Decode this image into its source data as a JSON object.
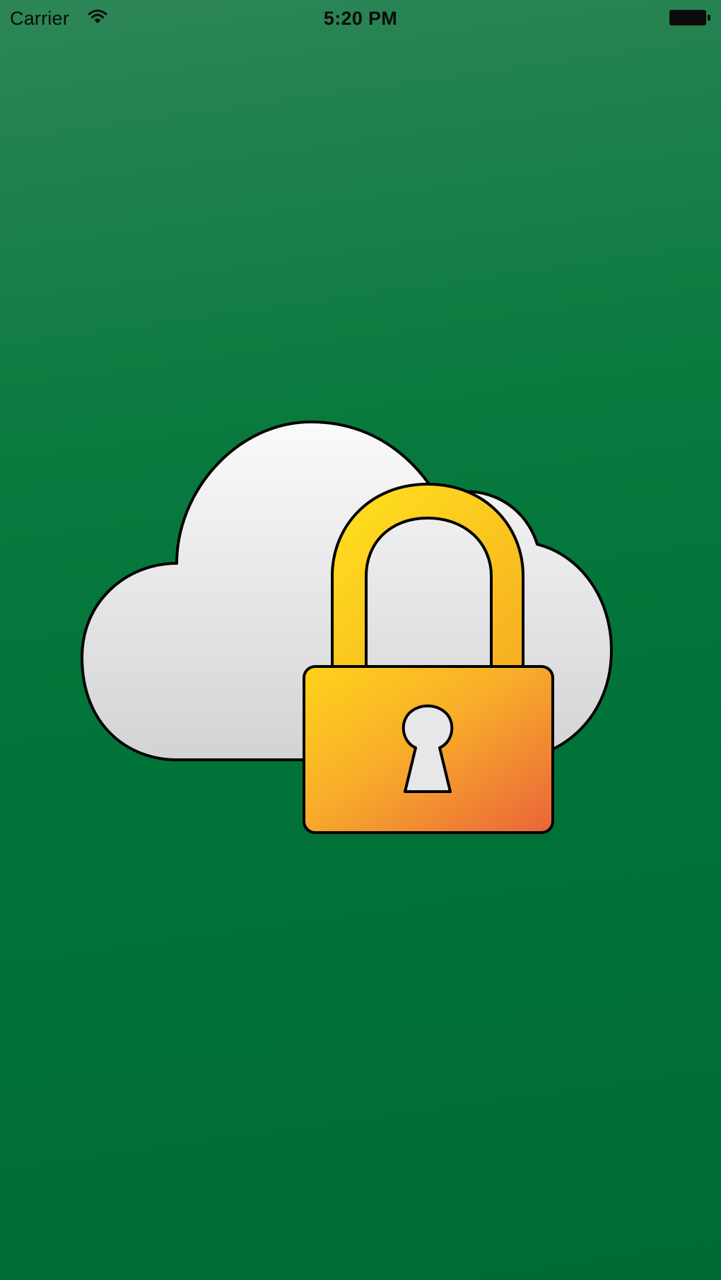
{
  "status_bar": {
    "carrier": "Carrier",
    "time": "5:20 PM",
    "wifi_icon": "wifi-icon",
    "battery_icon": "battery-icon"
  },
  "illustration": {
    "cloud_icon": "cloud-icon",
    "lock_icon": "padlock-icon"
  },
  "colors": {
    "background_top": "#2e8656",
    "background_bottom": "#006a34",
    "cloud_fill": "#f2f2f3",
    "lock_yellow": "#ffd21a",
    "lock_orange": "#e9673a",
    "outline": "#000000"
  }
}
